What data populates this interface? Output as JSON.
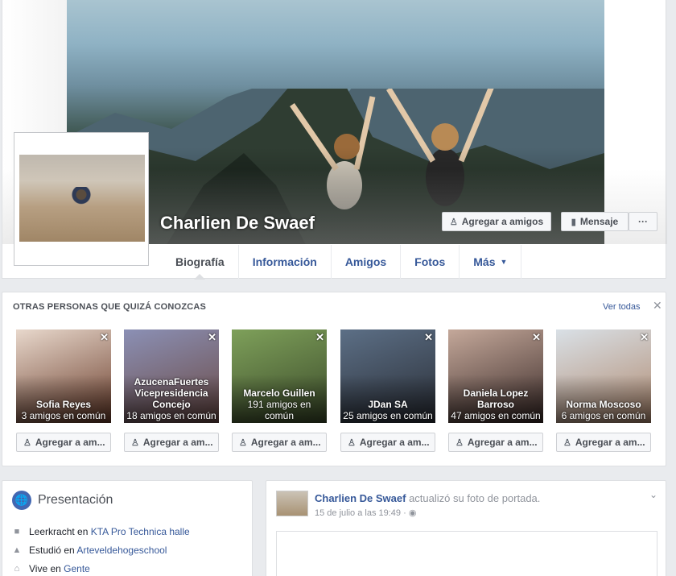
{
  "profile": {
    "name": "Charlien De Swaef",
    "buttons": {
      "add_friend": "Agregar a amigos",
      "message": "Mensaje",
      "more": "···"
    },
    "tabs": [
      {
        "label": "Biografía"
      },
      {
        "label": "Información"
      },
      {
        "label": "Amigos"
      },
      {
        "label": "Fotos"
      },
      {
        "label": "Más"
      }
    ]
  },
  "pymk": {
    "title": "OTRAS PERSONAS QUE QUIZÁ CONOZCAS",
    "see_all": "Ver todas",
    "close": "✕",
    "add_label": "Agregar a am...",
    "people": [
      {
        "name": "Sofia Reyes",
        "mutual": "3 amigos en común",
        "colors": [
          "#e8d8cc",
          "#6a3c2a"
        ]
      },
      {
        "name": "AzucenaFuertes Vicepresidencia Concejo",
        "mutual": "18 amigos en común",
        "colors": [
          "#8b90b5",
          "#6b4a45"
        ]
      },
      {
        "name": "Marcelo Guillen",
        "mutual": "191 amigos en común",
        "colors": [
          "#7ea05a",
          "#3b4a2a"
        ]
      },
      {
        "name": "JDan SA",
        "mutual": "25 amigos en común",
        "colors": [
          "#5c6f86",
          "#2a2e36"
        ]
      },
      {
        "name": "Daniela Lopez Barroso",
        "mutual": "47 amigos en común",
        "colors": [
          "#c4a89a",
          "#3a2a28"
        ]
      },
      {
        "name": "Norma Moscoso",
        "mutual": "6 amigos en común",
        "colors": [
          "#d9e0e6",
          "#b08a70"
        ]
      }
    ]
  },
  "intro": {
    "title": "Presentación",
    "rows": [
      {
        "icon": "briefcase-icon",
        "prefix": "Leerkracht en ",
        "link": "KTA Pro Technica halle"
      },
      {
        "icon": "graduation-cap-icon",
        "prefix": "Estudió en ",
        "link": "Arteveldehogeschool"
      },
      {
        "icon": "home-icon",
        "prefix": "Vive en ",
        "link": "Gente"
      }
    ]
  },
  "post": {
    "author": "Charlien De Swaef",
    "action": "actualizó su foto de portada.",
    "time": "15 de julio a las 19:49 ·"
  }
}
